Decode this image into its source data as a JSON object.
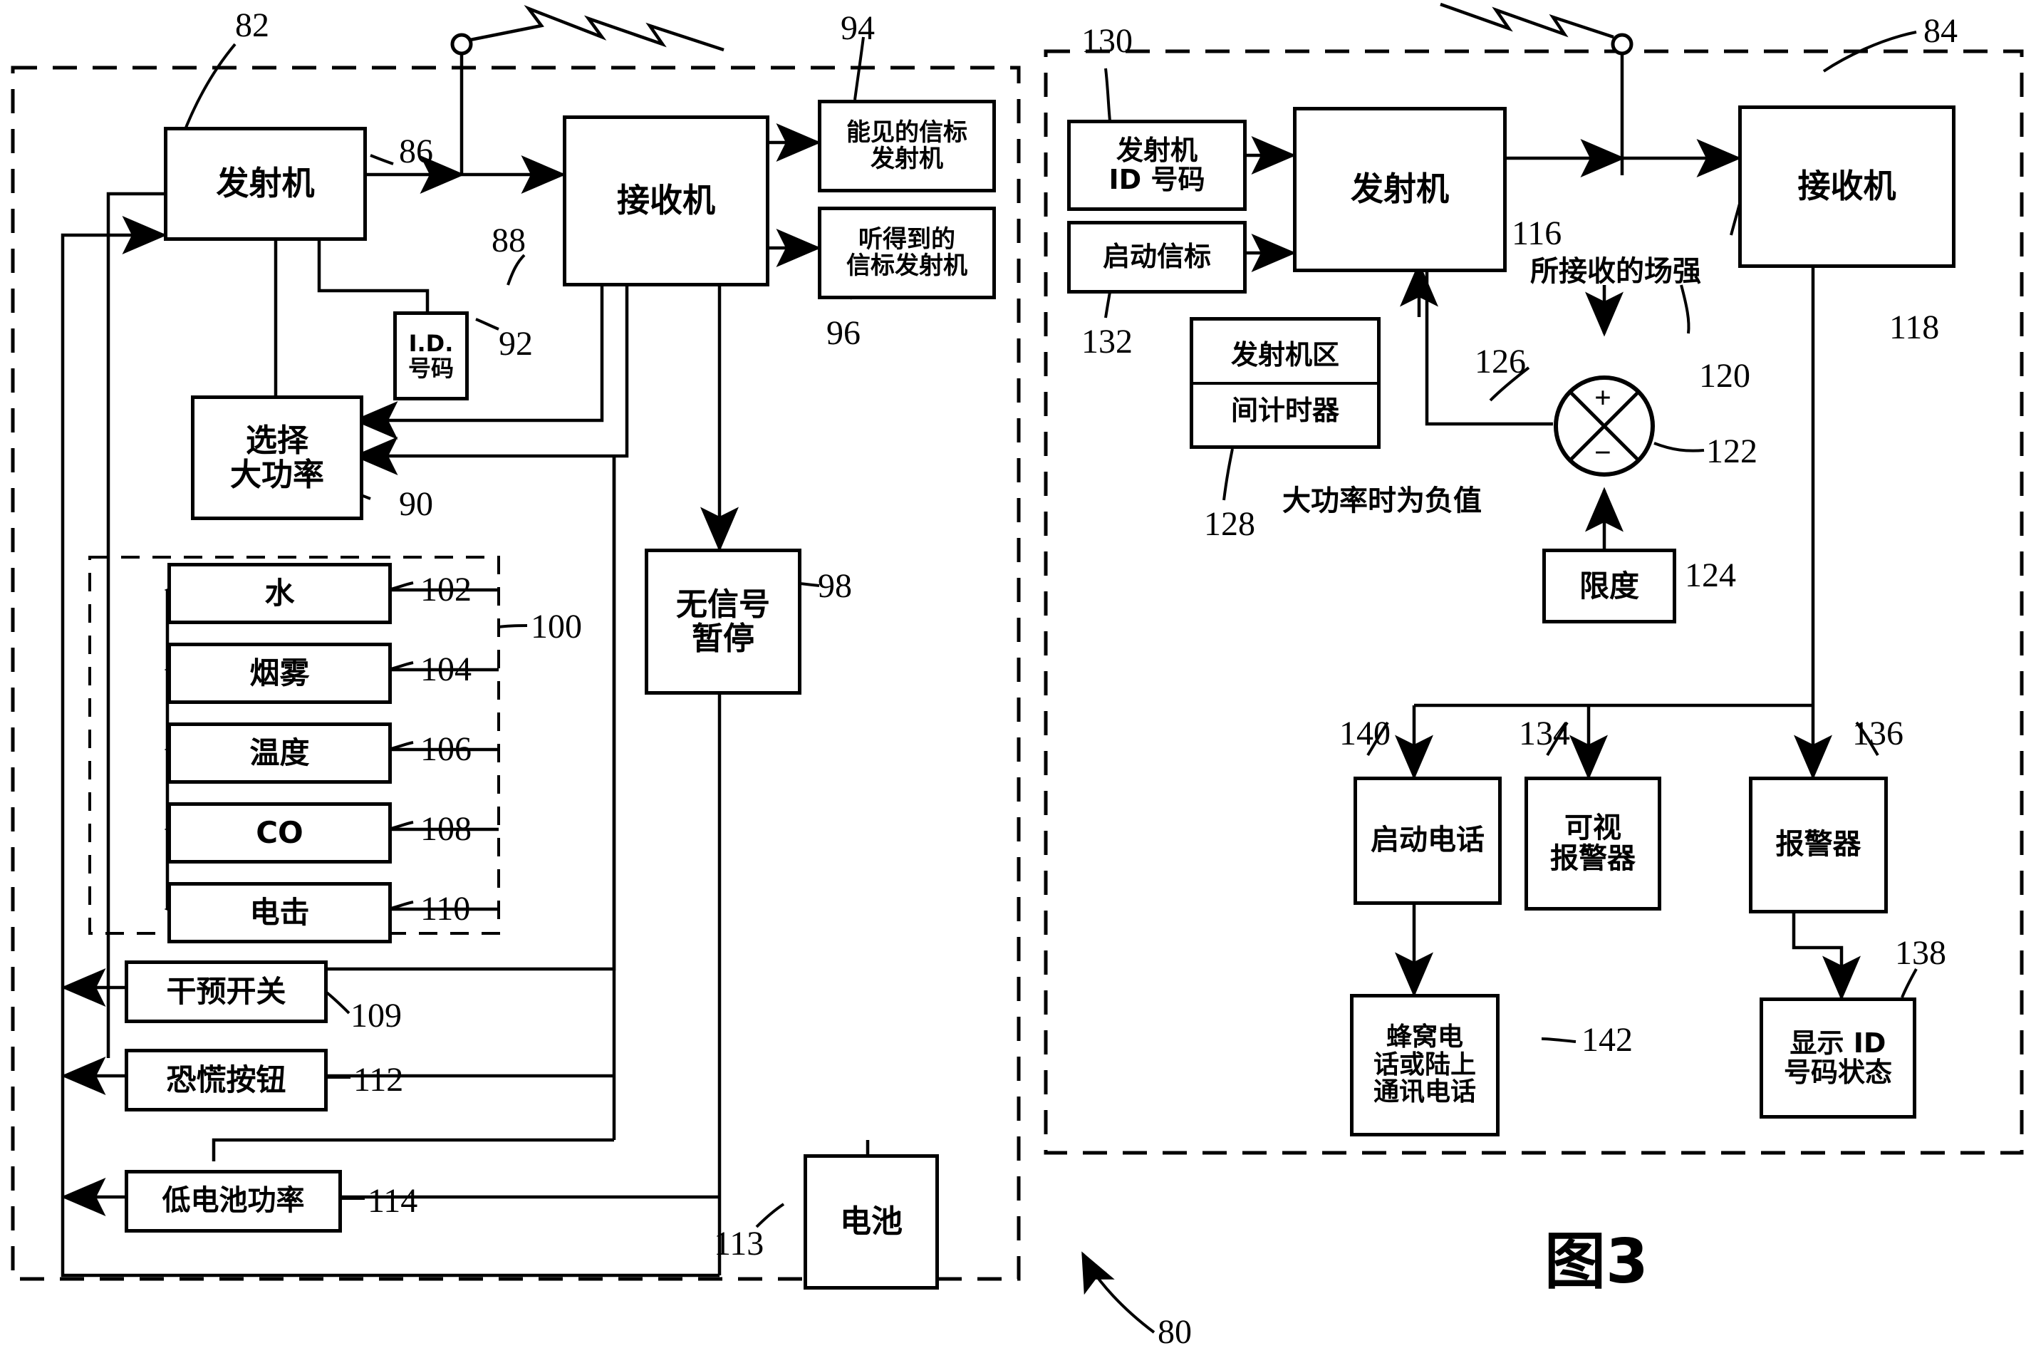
{
  "figure": {
    "label": "图3",
    "left_panel_ref": "82",
    "right_panel_ref": "84",
    "system_ref": "80"
  },
  "left_panel": {
    "boxes": [
      {
        "id": "transmitter",
        "lines": [
          "发射机"
        ],
        "ref": "86"
      },
      {
        "id": "receiver",
        "lines": [
          "接收机"
        ],
        "ref": "88"
      },
      {
        "id": "id_number",
        "lines": [
          "I.D.",
          "号码"
        ],
        "ref": "92"
      },
      {
        "id": "visible_beacon_transmitter",
        "lines": [
          "能见的信标",
          "发射机"
        ],
        "ref": "94"
      },
      {
        "id": "audible_beacon_transmitter",
        "lines": [
          "听得到的",
          "信标发射机"
        ],
        "ref": "96"
      },
      {
        "id": "select_high_power",
        "lines": [
          "选择",
          "大功率"
        ],
        "ref": "90"
      },
      {
        "id": "no_signal_pause",
        "lines": [
          "无信号",
          "暂停"
        ],
        "ref": "98"
      },
      {
        "id": "water",
        "lines": [
          "水"
        ],
        "ref": "102"
      },
      {
        "id": "smoke",
        "lines": [
          "烟雾"
        ],
        "ref": "104"
      },
      {
        "id": "temperature",
        "lines": [
          "温度"
        ],
        "ref": "106"
      },
      {
        "id": "co",
        "lines": [
          "CO"
        ],
        "ref": "108"
      },
      {
        "id": "shock",
        "lines": [
          "电击"
        ],
        "ref": "110"
      },
      {
        "id": "intervention_switch",
        "lines": [
          "干预开关"
        ],
        "ref": "109"
      },
      {
        "id": "panic_button",
        "lines": [
          "恐慌按钮"
        ],
        "ref": "112"
      },
      {
        "id": "low_battery_power",
        "lines": [
          "低电池功率"
        ],
        "ref": "114"
      },
      {
        "id": "battery",
        "lines": [
          "电池"
        ],
        "ref": "113"
      }
    ],
    "sensor_group_ref": "100"
  },
  "right_panel": {
    "boxes": [
      {
        "id": "transmitter_id_number",
        "lines": [
          "发射机",
          "ID 号码"
        ],
        "ref": "130"
      },
      {
        "id": "activate_beacon",
        "lines": [
          "启动信标"
        ],
        "ref": "132"
      },
      {
        "id": "transmitter_zone_interval_timer",
        "lines": [
          "发射机区",
          "间计时器"
        ],
        "ref": "128"
      },
      {
        "id": "transmitter",
        "lines": [
          "发射机"
        ],
        "ref": "116"
      },
      {
        "id": "receiver",
        "lines": [
          "接收机"
        ],
        "ref": "118"
      },
      {
        "id": "limit",
        "lines": [
          "限度"
        ],
        "ref": "124"
      },
      {
        "id": "activate_phone",
        "lines": [
          "启动电话"
        ],
        "ref": "140"
      },
      {
        "id": "visual_alarm",
        "lines": [
          "可视",
          "报警器"
        ],
        "ref": "134"
      },
      {
        "id": "alarm",
        "lines": [
          "报警器"
        ],
        "ref": "136"
      },
      {
        "id": "cellular_or_landline_phone",
        "lines": [
          "蜂窝电",
          "话或陆上",
          "通讯电话"
        ],
        "ref": "142"
      },
      {
        "id": "display_id_status",
        "lines": [
          "显示 ID",
          "号码状态"
        ],
        "ref": "138"
      }
    ],
    "annotations": [
      {
        "id": "received_field_strength",
        "text": "所接收的场强",
        "ref": "120"
      },
      {
        "id": "negative_at_high_power",
        "text": "大功率时为负值",
        "ref": "126"
      },
      {
        "id": "summing_junction",
        "plus": "+",
        "minus": "−",
        "ref": "122"
      }
    ]
  },
  "colors": {
    "ink": "#000000",
    "paper": "#ffffff"
  }
}
